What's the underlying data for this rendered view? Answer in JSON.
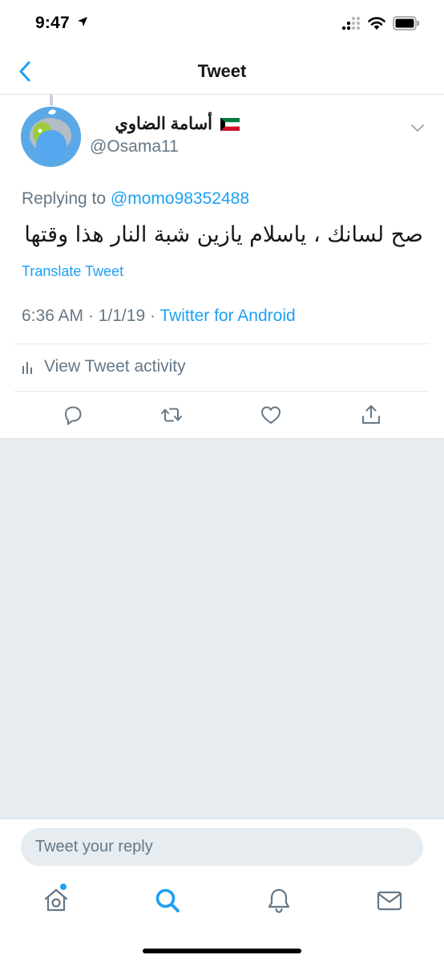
{
  "status_bar": {
    "time": "9:47"
  },
  "nav": {
    "title": "Tweet"
  },
  "tweet": {
    "display_name": "أسامة الضاوي",
    "handle": "@Osama11",
    "replying_prefix": "Replying to ",
    "replying_to": "@momo98352488",
    "text": "صح لسانك ، ياسلام يازين شبة النار هذا وقتها",
    "translate_label": "Translate Tweet",
    "time": "6:36 AM",
    "separator": " · ",
    "date": "1/1/19",
    "source": "Twitter for Android"
  },
  "activity": {
    "label": "View Tweet activity"
  },
  "reply": {
    "placeholder": "Tweet your reply"
  },
  "colors": {
    "accent": "#1da1f2",
    "secondary_text": "#657786",
    "background_gray": "#e6ecf0"
  },
  "icons": {
    "back": "chevron-left-icon",
    "caret": "chevron-down-icon",
    "actions": [
      "reply-icon",
      "retweet-icon",
      "like-icon",
      "share-icon"
    ],
    "tabs": [
      "home-icon",
      "search-icon",
      "notifications-icon",
      "messages-icon"
    ]
  }
}
